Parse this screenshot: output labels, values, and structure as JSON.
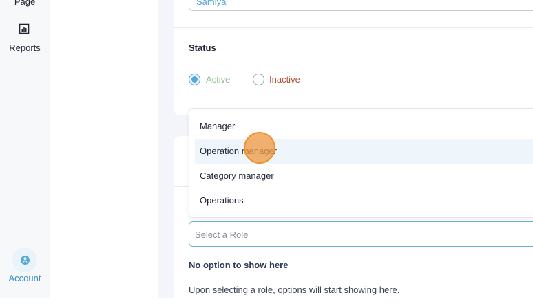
{
  "sidebar": {
    "page_label": "Page",
    "reports_label": "Reports",
    "reports_icon": "bar-chart-icon",
    "account_label": "Account",
    "account_icon": "user-icon"
  },
  "form": {
    "name_value": "Samiya",
    "status_label": "Status",
    "status_options": [
      "Active",
      "Inactive"
    ],
    "status_selected": "Active",
    "role_placeholder": "Select a Role",
    "no_option_text": "No option to show here",
    "hint_text": "Upon selecting a role, options will start showing here."
  },
  "dropdown": {
    "options": [
      "Manager",
      "Operation manager",
      "Category manager",
      "Operations"
    ],
    "highlighted": "Operation manager"
  },
  "colors": {
    "accent": "#54a8d6",
    "active_text": "#8bc48f",
    "inactive_text": "#b0523a",
    "cursor": "#f09b46"
  }
}
